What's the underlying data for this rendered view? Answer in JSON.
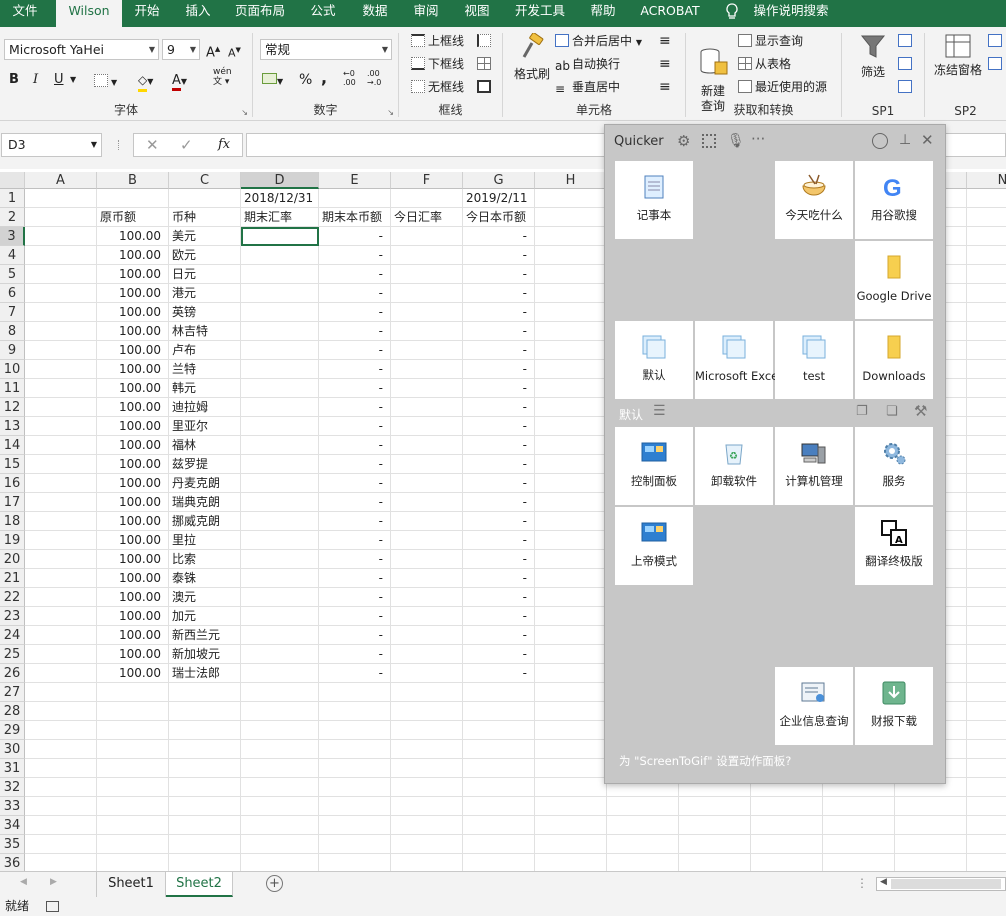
{
  "tabs": [
    "文件",
    "Wilson",
    "开始",
    "插入",
    "页面布局",
    "公式",
    "数据",
    "审阅",
    "视图",
    "开发工具",
    "帮助",
    "ACROBAT",
    "操作说明搜索"
  ],
  "ribbon": {
    "font_name": "Microsoft YaHei",
    "font_size": "9",
    "font_group": "字体",
    "number_format": "常规",
    "number_group": "数字",
    "border_top": "上框线",
    "border_bottom": "下框线",
    "border_none": "无框线",
    "border_group": "框线",
    "format_painter": "格式刷",
    "merge_center": "合并后居中",
    "wrap_text": "自动换行",
    "v_center": "垂直居中",
    "cell_group": "单元格",
    "new_query": "新建\n查询",
    "show_query": "显示查询",
    "from_table": "从表格",
    "recent_sources": "最近使用的源",
    "get_transform_group": "获取和转换",
    "filter": "筛选",
    "sp1_group": "SP1",
    "freeze_panes": "冻结窗格",
    "sp2_group": "SP2",
    "percent": "%",
    "comma": ",",
    "bold": "B",
    "italic": "I",
    "underline": "U"
  },
  "formula_bar": {
    "name_box": "D3",
    "fx": "fx",
    "formula": ""
  },
  "columns": [
    "A",
    "B",
    "C",
    "D",
    "E",
    "F",
    "G",
    "H"
  ],
  "last_col": "N",
  "header_row1": {
    "D": "2018/12/31",
    "G": "2019/2/11"
  },
  "header_row2": {
    "B": "原币额",
    "C": "币种",
    "D": "期末汇率",
    "E": "期末本币额",
    "F": "今日汇率",
    "G": "今日本币额"
  },
  "rows": [
    {
      "b": "100.00",
      "c": "美元",
      "e": "-",
      "g": "-"
    },
    {
      "b": "100.00",
      "c": "欧元",
      "e": "-",
      "g": "-"
    },
    {
      "b": "100.00",
      "c": "日元",
      "e": "-",
      "g": "-"
    },
    {
      "b": "100.00",
      "c": "港元",
      "e": "-",
      "g": "-"
    },
    {
      "b": "100.00",
      "c": "英镑",
      "e": "-",
      "g": "-"
    },
    {
      "b": "100.00",
      "c": "林吉特",
      "e": "-",
      "g": "-"
    },
    {
      "b": "100.00",
      "c": "卢布",
      "e": "-",
      "g": "-"
    },
    {
      "b": "100.00",
      "c": "兰特",
      "e": "-",
      "g": "-"
    },
    {
      "b": "100.00",
      "c": "韩元",
      "e": "-",
      "g": "-"
    },
    {
      "b": "100.00",
      "c": "迪拉姆",
      "e": "-",
      "g": "-"
    },
    {
      "b": "100.00",
      "c": "里亚尔",
      "e": "-",
      "g": "-"
    },
    {
      "b": "100.00",
      "c": "福林",
      "e": "-",
      "g": "-"
    },
    {
      "b": "100.00",
      "c": "兹罗提",
      "e": "-",
      "g": "-"
    },
    {
      "b": "100.00",
      "c": "丹麦克朗",
      "e": "-",
      "g": "-"
    },
    {
      "b": "100.00",
      "c": "瑞典克朗",
      "e": "-",
      "g": "-"
    },
    {
      "b": "100.00",
      "c": "挪威克朗",
      "e": "-",
      "g": "-"
    },
    {
      "b": "100.00",
      "c": "里拉",
      "e": "-",
      "g": "-"
    },
    {
      "b": "100.00",
      "c": "比索",
      "e": "-",
      "g": "-"
    },
    {
      "b": "100.00",
      "c": "泰铢",
      "e": "-",
      "g": "-"
    },
    {
      "b": "100.00",
      "c": "澳元",
      "e": "-",
      "g": "-"
    },
    {
      "b": "100.00",
      "c": "加元",
      "e": "-",
      "g": "-"
    },
    {
      "b": "100.00",
      "c": "新西兰元",
      "e": "-",
      "g": "-"
    },
    {
      "b": "100.00",
      "c": "新加坡元",
      "e": "-",
      "g": "-"
    },
    {
      "b": "100.00",
      "c": "瑞士法郎",
      "e": "-",
      "g": "-"
    }
  ],
  "row_numbers": [
    "1",
    "2",
    "3",
    "4",
    "5",
    "6",
    "7",
    "8",
    "9",
    "10",
    "11",
    "12",
    "13",
    "14",
    "15",
    "16",
    "17",
    "18",
    "19",
    "20",
    "21",
    "22",
    "23",
    "24",
    "25",
    "26",
    "27",
    "28",
    "29",
    "30",
    "31",
    "32",
    "33",
    "34",
    "35",
    "36"
  ],
  "sheets": [
    "Sheet1",
    "Sheet2"
  ],
  "active_sheet": "Sheet2",
  "status": "就绪",
  "quicker": {
    "title": "Quicker",
    "top_tiles": [
      {
        "label": "记事本",
        "icon": "notepad-icon"
      },
      {
        "label": "今天吃什么",
        "icon": "food-bowl-icon"
      },
      {
        "label": "用谷歌搜",
        "icon": "google-icon"
      },
      {
        "label": "Google Drive",
        "icon": "folder-icon"
      },
      {
        "label": "默认",
        "icon": "pages-icon"
      },
      {
        "label": "Microsoft Excel",
        "icon": "pages-icon"
      },
      {
        "label": "test",
        "icon": "pages-icon"
      },
      {
        "label": "Downloads",
        "icon": "folder-icon"
      }
    ],
    "section_label": "默认",
    "bottom_tiles": [
      {
        "label": "控制面板",
        "icon": "control-panel-icon"
      },
      {
        "label": "卸载软件",
        "icon": "recycle-bin-icon"
      },
      {
        "label": "计算机管理",
        "icon": "computer-management-icon"
      },
      {
        "label": "服务",
        "icon": "gears-icon"
      },
      {
        "label": "上帝模式",
        "icon": "control-panel-icon"
      },
      {
        "label": "翻译终极版",
        "icon": "translate-icon"
      },
      {
        "label": "企业信息查询",
        "icon": "company-info-icon"
      },
      {
        "label": "财报下载",
        "icon": "download-icon"
      }
    ],
    "footer": "为 \"ScreenToGif\" 设置动作面板?"
  }
}
